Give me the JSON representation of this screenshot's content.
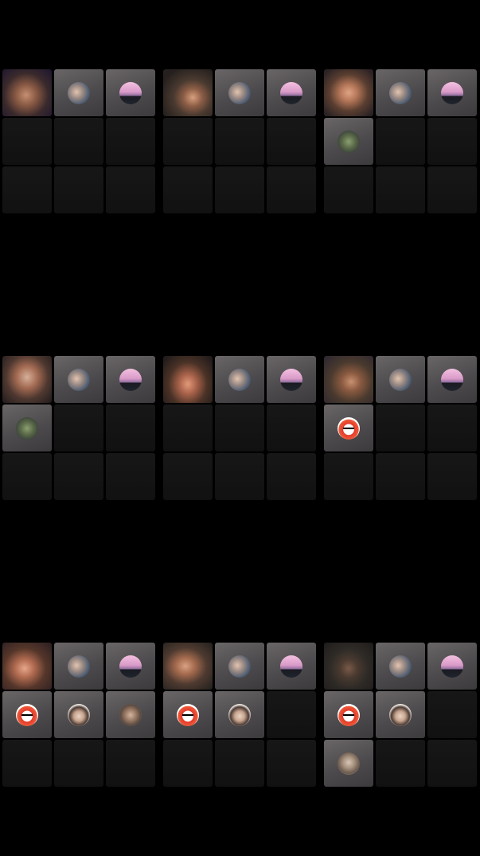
{
  "app": {
    "title": ""
  },
  "colors": {
    "background": "#000000",
    "empty_tile": "#141414",
    "avatar_tile": "#555355"
  },
  "panels": [
    {
      "name": "grid-1",
      "tiles": [
        {
          "kind": "camera",
          "variant": "v1"
        },
        {
          "kind": "avatar",
          "avatar": "selfie"
        },
        {
          "kind": "avatar",
          "avatar": "sunset"
        },
        {
          "kind": "empty"
        },
        {
          "kind": "empty"
        },
        {
          "kind": "empty"
        },
        {
          "kind": "empty"
        },
        {
          "kind": "empty"
        },
        {
          "kind": "empty"
        }
      ]
    },
    {
      "name": "grid-2",
      "tiles": [
        {
          "kind": "camera",
          "variant": "v2"
        },
        {
          "kind": "avatar",
          "avatar": "selfie"
        },
        {
          "kind": "avatar",
          "avatar": "sunset"
        },
        {
          "kind": "empty"
        },
        {
          "kind": "empty"
        },
        {
          "kind": "empty"
        },
        {
          "kind": "empty"
        },
        {
          "kind": "empty"
        },
        {
          "kind": "empty"
        }
      ]
    },
    {
      "name": "grid-3",
      "tiles": [
        {
          "kind": "camera",
          "variant": "v3"
        },
        {
          "kind": "avatar",
          "avatar": "selfie"
        },
        {
          "kind": "avatar",
          "avatar": "sunset"
        },
        {
          "kind": "avatar",
          "avatar": "plant"
        },
        {
          "kind": "empty"
        },
        {
          "kind": "empty"
        },
        {
          "kind": "empty"
        },
        {
          "kind": "empty"
        },
        {
          "kind": "empty"
        }
      ]
    },
    {
      "name": "grid-4",
      "tiles": [
        {
          "kind": "camera",
          "variant": "v4"
        },
        {
          "kind": "avatar",
          "avatar": "selfie"
        },
        {
          "kind": "avatar",
          "avatar": "sunset"
        },
        {
          "kind": "avatar",
          "avatar": "plant"
        },
        {
          "kind": "empty"
        },
        {
          "kind": "empty"
        },
        {
          "kind": "empty"
        },
        {
          "kind": "empty"
        },
        {
          "kind": "empty"
        }
      ]
    },
    {
      "name": "grid-5",
      "tiles": [
        {
          "kind": "camera",
          "variant": "v5"
        },
        {
          "kind": "avatar",
          "avatar": "selfie"
        },
        {
          "kind": "avatar",
          "avatar": "sunset"
        },
        {
          "kind": "empty"
        },
        {
          "kind": "empty"
        },
        {
          "kind": "empty"
        },
        {
          "kind": "empty"
        },
        {
          "kind": "empty"
        },
        {
          "kind": "empty"
        }
      ]
    },
    {
      "name": "grid-6",
      "tiles": [
        {
          "kind": "camera",
          "variant": "v6"
        },
        {
          "kind": "avatar",
          "avatar": "selfie"
        },
        {
          "kind": "avatar",
          "avatar": "sunset"
        },
        {
          "kind": "avatar",
          "avatar": "redhair"
        },
        {
          "kind": "empty"
        },
        {
          "kind": "empty"
        },
        {
          "kind": "empty"
        },
        {
          "kind": "empty"
        },
        {
          "kind": "empty"
        }
      ]
    },
    {
      "name": "grid-7",
      "tiles": [
        {
          "kind": "camera",
          "variant": "v7"
        },
        {
          "kind": "avatar",
          "avatar": "selfie"
        },
        {
          "kind": "avatar",
          "avatar": "sunset"
        },
        {
          "kind": "avatar",
          "avatar": "redhair"
        },
        {
          "kind": "avatar",
          "avatar": "boy"
        },
        {
          "kind": "avatar",
          "avatar": "girl"
        },
        {
          "kind": "empty"
        },
        {
          "kind": "empty"
        },
        {
          "kind": "empty"
        }
      ]
    },
    {
      "name": "grid-8",
      "tiles": [
        {
          "kind": "camera",
          "variant": "v8"
        },
        {
          "kind": "avatar",
          "avatar": "selfie"
        },
        {
          "kind": "avatar",
          "avatar": "sunset"
        },
        {
          "kind": "avatar",
          "avatar": "redhair"
        },
        {
          "kind": "avatar",
          "avatar": "boy"
        },
        {
          "kind": "empty"
        },
        {
          "kind": "empty"
        },
        {
          "kind": "empty"
        },
        {
          "kind": "empty"
        }
      ]
    },
    {
      "name": "grid-9",
      "tiles": [
        {
          "kind": "camera",
          "variant": "v9"
        },
        {
          "kind": "avatar",
          "avatar": "selfie"
        },
        {
          "kind": "avatar",
          "avatar": "sunset"
        },
        {
          "kind": "avatar",
          "avatar": "redhair"
        },
        {
          "kind": "avatar",
          "avatar": "boy"
        },
        {
          "kind": "empty"
        },
        {
          "kind": "avatar",
          "avatar": "girl2"
        },
        {
          "kind": "empty"
        },
        {
          "kind": "empty"
        }
      ]
    }
  ]
}
